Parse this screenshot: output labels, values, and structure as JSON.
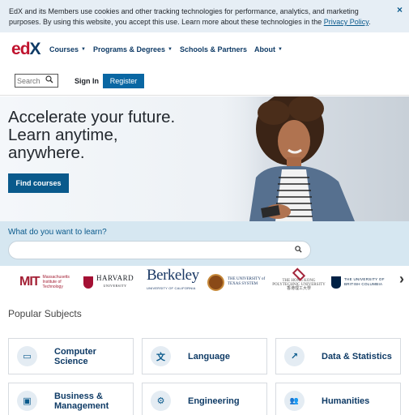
{
  "cookie_banner": {
    "text": "EdX and its Members use cookies and other tracking technologies for performance, analytics, and marketing purposes. By using this website, you accept this use. Learn more about these technologies in the ",
    "link_label": "Privacy Policy",
    "period": ".",
    "close_icon": "×"
  },
  "header": {
    "logo_e": "e",
    "logo_d": "d",
    "logo_x": "X",
    "nav": [
      {
        "label": "Courses",
        "has_caret": true
      },
      {
        "label": "Programs & Degrees",
        "has_caret": true
      },
      {
        "label": "Schools & Partners",
        "has_caret": false
      },
      {
        "label": "About",
        "has_caret": true
      }
    ],
    "caret_icon": "▼",
    "search_placeholder": "Search",
    "search_icon": "⚲",
    "signin_label": "Sign In",
    "register_label": "Register"
  },
  "hero": {
    "title": "Accelerate your future. Learn anytime, anywhere.",
    "cta_label": "Find courses"
  },
  "learn": {
    "label": "What do you want to learn?",
    "search_value": "",
    "search_icon": "⚲"
  },
  "partners": {
    "mit_mark": "MIT",
    "mit_text": "Massachusetts Institute of Technology",
    "harvard_text": "HARVARD",
    "harvard_sub": "UNIVERSITY",
    "berkeley_text": "Berkeley",
    "berkeley_sub": "UNIVERSITY OF CALIFORNIA",
    "texas_text": "THE UNIVERSITY of TEXAS SYSTEM",
    "hk_text": "THE HONG KONG POLYTECHNIC UNIVERSITY",
    "hk_sub": "香港理工大學",
    "ubc_text": "THE UNIVERSITY OF BRITISH COLUMBIA",
    "next_icon": "›"
  },
  "popular": {
    "title": "Popular Subjects",
    "subjects": [
      {
        "label": "Computer Science",
        "icon": "computer-icon",
        "glyph": "▭"
      },
      {
        "label": "Language",
        "icon": "language-icon",
        "glyph": "文"
      },
      {
        "label": "Data & Statistics",
        "icon": "chart-icon",
        "glyph": "↗"
      },
      {
        "label": "Business & Management",
        "icon": "briefcase-icon",
        "glyph": "▣"
      },
      {
        "label": "Engineering",
        "icon": "gears-icon",
        "glyph": "⚙"
      },
      {
        "label": "Humanities",
        "icon": "people-icon",
        "glyph": "👥"
      }
    ]
  },
  "colors": {
    "brand_red": "#c0142f",
    "brand_navy": "#0f3b66",
    "primary_button": "#0a67a3",
    "cta_button": "#0a5a8c"
  }
}
